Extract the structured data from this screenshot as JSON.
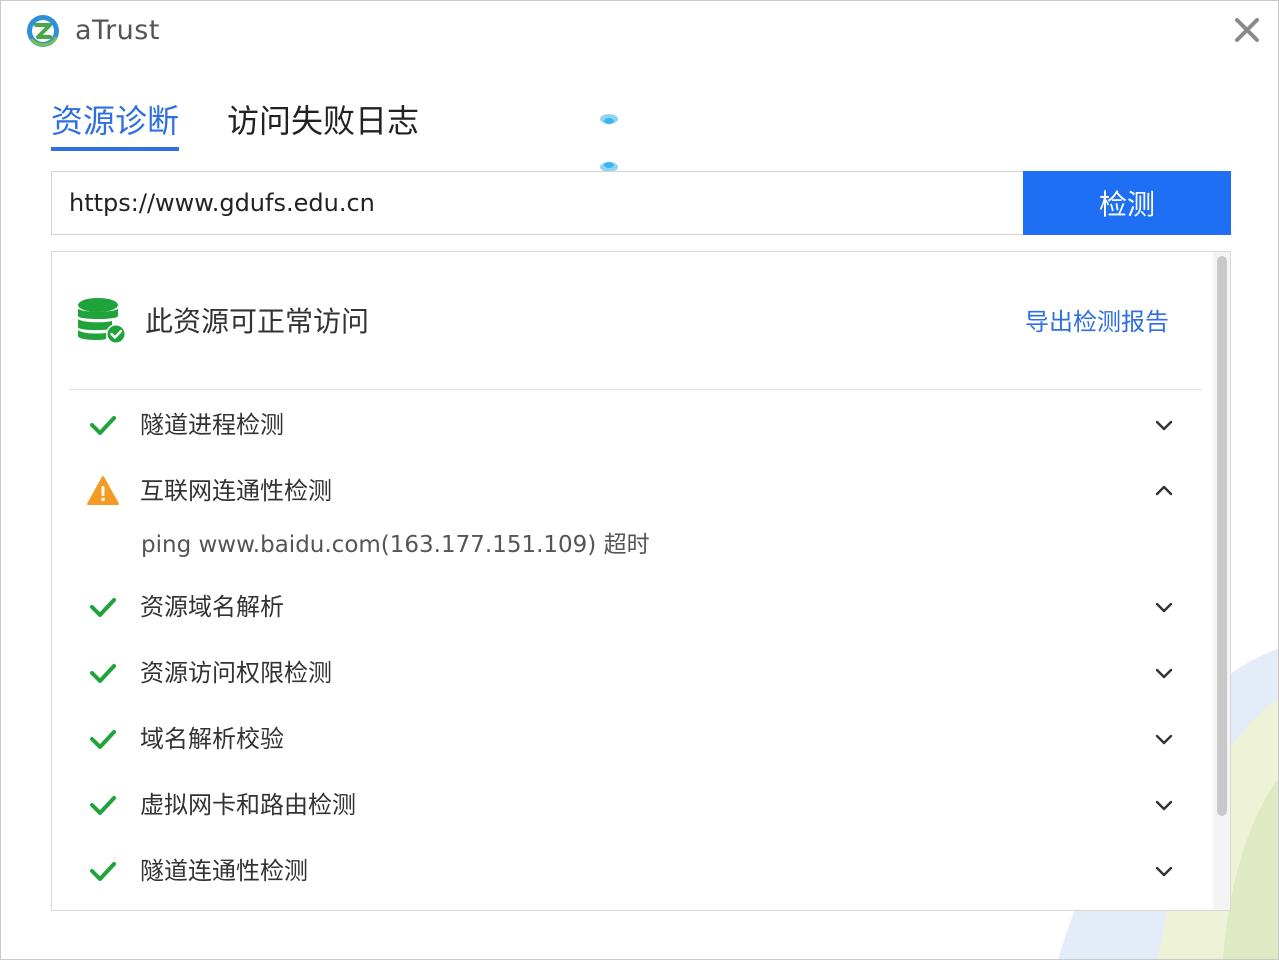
{
  "app": {
    "title": "aTrust",
    "logo_icon": "atrust-logo-icon",
    "close_icon": "close-icon"
  },
  "tabs": [
    {
      "label": "资源诊断",
      "active": true
    },
    {
      "label": "访问失败日志",
      "active": false
    }
  ],
  "search": {
    "url_value": "https://www.gdufs.edu.cn",
    "button_label": "检测"
  },
  "result": {
    "status_icon": "database-check-icon",
    "status_text": "此资源可正常访问",
    "export_label": "导出检测报告"
  },
  "checks": [
    {
      "label": "隧道进程检测",
      "state": "ok",
      "expanded": false
    },
    {
      "label": "互联网连通性检测",
      "state": "warning",
      "expanded": true,
      "detail": "ping www.baidu.com(163.177.151.109) 超时"
    },
    {
      "label": "资源域名解析",
      "state": "ok",
      "expanded": false
    },
    {
      "label": "资源访问权限检测",
      "state": "ok",
      "expanded": false
    },
    {
      "label": "域名解析校验",
      "state": "ok",
      "expanded": false
    },
    {
      "label": "虚拟网卡和路由检测",
      "state": "ok",
      "expanded": false
    },
    {
      "label": "隧道连通性检测",
      "state": "ok",
      "expanded": false
    }
  ],
  "colors": {
    "accent": "#2f6fe0",
    "button": "#1f6ff5",
    "ok": "#1fa33a",
    "warning": "#f59a23"
  }
}
